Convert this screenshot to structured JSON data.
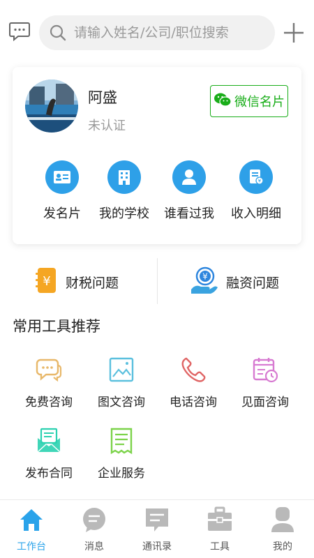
{
  "search": {
    "placeholder": "请输入姓名/公司/职位搜索"
  },
  "profile": {
    "name": "阿盛",
    "status": "未认证",
    "wechat_card_label": "微信名片"
  },
  "quick_actions": [
    {
      "label": "发名片",
      "icon": "business-card-icon"
    },
    {
      "label": "我的学校",
      "icon": "building-icon"
    },
    {
      "label": "谁看过我",
      "icon": "person-icon"
    },
    {
      "label": "收入明细",
      "icon": "document-yuan-icon"
    }
  ],
  "banners": [
    {
      "label": "财税问题",
      "icon": "yuan-note-icon",
      "color": "#f5a623"
    },
    {
      "label": "融资问题",
      "icon": "yuan-hand-icon",
      "color": "#2e86de"
    }
  ],
  "tools": {
    "title": "常用工具推荐",
    "items": [
      {
        "label": "免费咨询",
        "icon": "chat-bubbles-icon",
        "color": "#e8b86a"
      },
      {
        "label": "图文咨询",
        "icon": "image-icon",
        "color": "#5bc0de"
      },
      {
        "label": "电话咨询",
        "icon": "phone-icon",
        "color": "#e06666"
      },
      {
        "label": "见面咨询",
        "icon": "calendar-clock-icon",
        "color": "#d77ad1"
      },
      {
        "label": "发布合同",
        "icon": "contract-envelope-icon",
        "color": "#2bd1b0"
      },
      {
        "label": "企业服务",
        "icon": "enterprise-doc-icon",
        "color": "#7cd34a"
      }
    ]
  },
  "tabbar": {
    "items": [
      {
        "label": "工作台",
        "icon": "home-icon",
        "active": true
      },
      {
        "label": "消息",
        "icon": "message-icon",
        "active": false
      },
      {
        "label": "通讯录",
        "icon": "contacts-icon",
        "active": false
      },
      {
        "label": "工具",
        "icon": "toolbox-icon",
        "active": false
      },
      {
        "label": "我的",
        "icon": "profile-icon",
        "active": false
      }
    ]
  },
  "colors": {
    "accent": "#2aa3ea",
    "wechat": "#19ad19",
    "inactive_tab": "#b9b9b9"
  }
}
